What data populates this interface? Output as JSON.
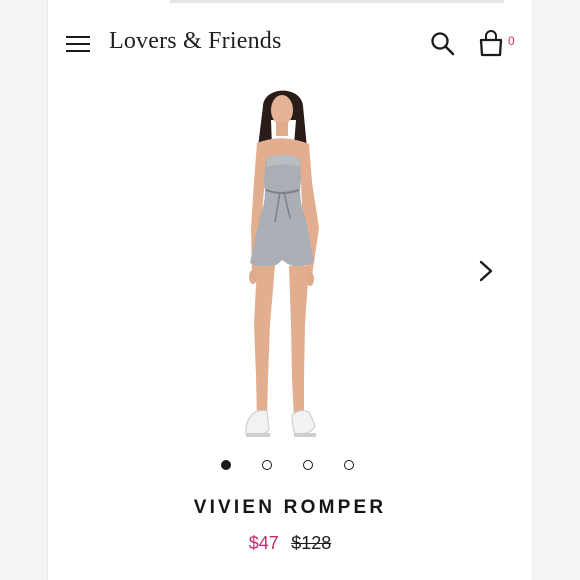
{
  "header": {
    "brand": "Lovers & Friends",
    "menu_icon": "menu-icon",
    "search_icon": "search-icon",
    "bag_icon": "shopping-bag-icon",
    "bag_count": "0"
  },
  "product": {
    "image_alt": "Product photo",
    "next_icon": "chevron-right-icon",
    "carousel_total": 4,
    "carousel_active": 1,
    "title": "VIVIEN ROMPER",
    "sale_price": "$47",
    "original_price": "$128"
  },
  "colors": {
    "accent": "#c12d6e",
    "text": "#161616",
    "background": "#ffffff",
    "page_bg": "#f4f4f4"
  }
}
